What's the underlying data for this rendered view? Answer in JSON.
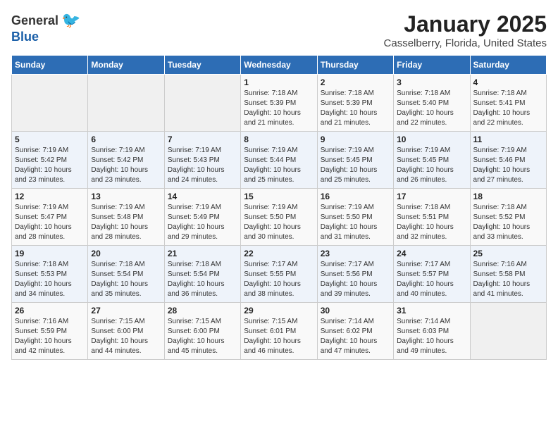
{
  "header": {
    "logo_general": "General",
    "logo_blue": "Blue",
    "title": "January 2025",
    "subtitle": "Casselberry, Florida, United States"
  },
  "weekdays": [
    "Sunday",
    "Monday",
    "Tuesday",
    "Wednesday",
    "Thursday",
    "Friday",
    "Saturday"
  ],
  "weeks": [
    [
      {
        "day": "",
        "sunrise": "",
        "sunset": "",
        "daylight": ""
      },
      {
        "day": "",
        "sunrise": "",
        "sunset": "",
        "daylight": ""
      },
      {
        "day": "",
        "sunrise": "",
        "sunset": "",
        "daylight": ""
      },
      {
        "day": "1",
        "sunrise": "7:18 AM",
        "sunset": "5:39 PM",
        "daylight": "10 hours and 21 minutes."
      },
      {
        "day": "2",
        "sunrise": "7:18 AM",
        "sunset": "5:39 PM",
        "daylight": "10 hours and 21 minutes."
      },
      {
        "day": "3",
        "sunrise": "7:18 AM",
        "sunset": "5:40 PM",
        "daylight": "10 hours and 22 minutes."
      },
      {
        "day": "4",
        "sunrise": "7:18 AM",
        "sunset": "5:41 PM",
        "daylight": "10 hours and 22 minutes."
      }
    ],
    [
      {
        "day": "5",
        "sunrise": "7:19 AM",
        "sunset": "5:42 PM",
        "daylight": "10 hours and 23 minutes."
      },
      {
        "day": "6",
        "sunrise": "7:19 AM",
        "sunset": "5:42 PM",
        "daylight": "10 hours and 23 minutes."
      },
      {
        "day": "7",
        "sunrise": "7:19 AM",
        "sunset": "5:43 PM",
        "daylight": "10 hours and 24 minutes."
      },
      {
        "day": "8",
        "sunrise": "7:19 AM",
        "sunset": "5:44 PM",
        "daylight": "10 hours and 25 minutes."
      },
      {
        "day": "9",
        "sunrise": "7:19 AM",
        "sunset": "5:45 PM",
        "daylight": "10 hours and 25 minutes."
      },
      {
        "day": "10",
        "sunrise": "7:19 AM",
        "sunset": "5:45 PM",
        "daylight": "10 hours and 26 minutes."
      },
      {
        "day": "11",
        "sunrise": "7:19 AM",
        "sunset": "5:46 PM",
        "daylight": "10 hours and 27 minutes."
      }
    ],
    [
      {
        "day": "12",
        "sunrise": "7:19 AM",
        "sunset": "5:47 PM",
        "daylight": "10 hours and 28 minutes."
      },
      {
        "day": "13",
        "sunrise": "7:19 AM",
        "sunset": "5:48 PM",
        "daylight": "10 hours and 28 minutes."
      },
      {
        "day": "14",
        "sunrise": "7:19 AM",
        "sunset": "5:49 PM",
        "daylight": "10 hours and 29 minutes."
      },
      {
        "day": "15",
        "sunrise": "7:19 AM",
        "sunset": "5:50 PM",
        "daylight": "10 hours and 30 minutes."
      },
      {
        "day": "16",
        "sunrise": "7:19 AM",
        "sunset": "5:50 PM",
        "daylight": "10 hours and 31 minutes."
      },
      {
        "day": "17",
        "sunrise": "7:18 AM",
        "sunset": "5:51 PM",
        "daylight": "10 hours and 32 minutes."
      },
      {
        "day": "18",
        "sunrise": "7:18 AM",
        "sunset": "5:52 PM",
        "daylight": "10 hours and 33 minutes."
      }
    ],
    [
      {
        "day": "19",
        "sunrise": "7:18 AM",
        "sunset": "5:53 PM",
        "daylight": "10 hours and 34 minutes."
      },
      {
        "day": "20",
        "sunrise": "7:18 AM",
        "sunset": "5:54 PM",
        "daylight": "10 hours and 35 minutes."
      },
      {
        "day": "21",
        "sunrise": "7:18 AM",
        "sunset": "5:54 PM",
        "daylight": "10 hours and 36 minutes."
      },
      {
        "day": "22",
        "sunrise": "7:17 AM",
        "sunset": "5:55 PM",
        "daylight": "10 hours and 38 minutes."
      },
      {
        "day": "23",
        "sunrise": "7:17 AM",
        "sunset": "5:56 PM",
        "daylight": "10 hours and 39 minutes."
      },
      {
        "day": "24",
        "sunrise": "7:17 AM",
        "sunset": "5:57 PM",
        "daylight": "10 hours and 40 minutes."
      },
      {
        "day": "25",
        "sunrise": "7:16 AM",
        "sunset": "5:58 PM",
        "daylight": "10 hours and 41 minutes."
      }
    ],
    [
      {
        "day": "26",
        "sunrise": "7:16 AM",
        "sunset": "5:59 PM",
        "daylight": "10 hours and 42 minutes."
      },
      {
        "day": "27",
        "sunrise": "7:15 AM",
        "sunset": "6:00 PM",
        "daylight": "10 hours and 44 minutes."
      },
      {
        "day": "28",
        "sunrise": "7:15 AM",
        "sunset": "6:00 PM",
        "daylight": "10 hours and 45 minutes."
      },
      {
        "day": "29",
        "sunrise": "7:15 AM",
        "sunset": "6:01 PM",
        "daylight": "10 hours and 46 minutes."
      },
      {
        "day": "30",
        "sunrise": "7:14 AM",
        "sunset": "6:02 PM",
        "daylight": "10 hours and 47 minutes."
      },
      {
        "day": "31",
        "sunrise": "7:14 AM",
        "sunset": "6:03 PM",
        "daylight": "10 hours and 49 minutes."
      },
      {
        "day": "",
        "sunrise": "",
        "sunset": "",
        "daylight": ""
      }
    ]
  ]
}
